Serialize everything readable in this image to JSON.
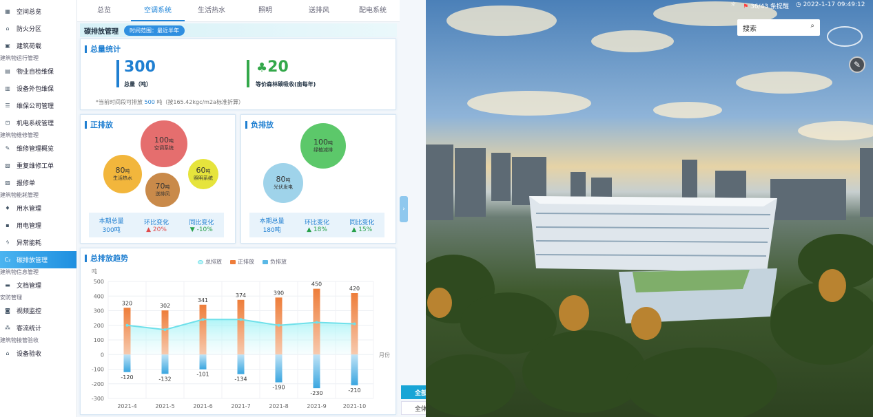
{
  "sidebar": {
    "entries": [
      {
        "type": "item",
        "label": "空间总览",
        "icon": "grid-icon",
        "glyph": "▦"
      },
      {
        "type": "item",
        "label": "防火分区",
        "icon": "home-icon",
        "glyph": "⌂"
      },
      {
        "type": "item",
        "label": "建筑荷载",
        "icon": "building-icon",
        "glyph": "▣"
      },
      {
        "type": "group",
        "label": "建筑物运行管理"
      },
      {
        "type": "item",
        "label": "物业自检维保",
        "icon": "clipboard-icon",
        "glyph": "▤"
      },
      {
        "type": "item",
        "label": "设备外包维保",
        "icon": "box-icon",
        "glyph": "▥"
      },
      {
        "type": "item",
        "label": "维保公司管理",
        "icon": "list-icon",
        "glyph": "☰"
      },
      {
        "type": "item",
        "label": "机电系统管理",
        "icon": "car-icon",
        "glyph": "⊡"
      },
      {
        "type": "group",
        "label": "建筑物维修管理"
      },
      {
        "type": "item",
        "label": "维修管理概览",
        "icon": "wrench-icon",
        "glyph": "✎"
      },
      {
        "type": "item",
        "label": "重复维修工单",
        "icon": "order-icon",
        "glyph": "▧"
      },
      {
        "type": "item",
        "label": "报修单",
        "icon": "form-icon",
        "glyph": "▨"
      },
      {
        "type": "group",
        "label": "建筑物能耗管理"
      },
      {
        "type": "item",
        "label": "用水管理",
        "icon": "drop-icon",
        "glyph": "♦"
      },
      {
        "type": "item",
        "label": "用电管理",
        "icon": "plug-icon",
        "glyph": "▪"
      },
      {
        "type": "item",
        "label": "异常能耗",
        "icon": "lightning-icon",
        "glyph": "ϟ"
      },
      {
        "type": "item",
        "label": "碳排放管理",
        "icon": "co2-icon",
        "glyph": "C₂",
        "active": true
      },
      {
        "type": "group",
        "label": "建筑物信息管理"
      },
      {
        "type": "item",
        "label": "文档管理",
        "icon": "folder-icon",
        "glyph": "▬"
      },
      {
        "type": "group",
        "label": "安防管理"
      },
      {
        "type": "item",
        "label": "视频监控",
        "icon": "camera-icon",
        "glyph": "◙"
      },
      {
        "type": "item",
        "label": "客流统计",
        "icon": "people-icon",
        "glyph": "⁂"
      },
      {
        "type": "group",
        "label": "建筑物接管验收"
      },
      {
        "type": "item",
        "label": "设备验收",
        "icon": "check-home-icon",
        "glyph": "⌂"
      }
    ],
    "top_cut_label": "空间总览"
  },
  "tabs": [
    "总览",
    "空调系统",
    "生活热水",
    "照明",
    "送排风",
    "配电系统"
  ],
  "active_tab": 1,
  "subbar": {
    "title": "碳排放管理",
    "pill": "时间范围：最近半年"
  },
  "total": {
    "title": "总量统计",
    "value": "300",
    "value_label": "总量（吨）",
    "forest_value": "20",
    "forest_label": "等价森林碳吸收(亩每年)",
    "note_prefix": "*当前时间段可排放",
    "note_value": "500",
    "note_suffix": "吨（按165.42kgc/m2a标准折算）"
  },
  "positive": {
    "title": "正排放",
    "bubbles": [
      {
        "value": "100",
        "unit": "吨",
        "label": "空调系统",
        "color": "#e56e6e"
      },
      {
        "value": "80",
        "unit": "吨",
        "label": "生活热水",
        "color": "#f2b63c"
      },
      {
        "value": "70",
        "unit": "吨",
        "label": "送排风",
        "color": "#c98a4a"
      },
      {
        "value": "60",
        "unit": "吨",
        "label": "照明系统",
        "color": "#e6e43c"
      }
    ],
    "stats": {
      "k1": "本期总量",
      "v1": "300吨",
      "k2": "环比变化",
      "v2": "▲ 20%",
      "k3": "同比变化",
      "v3": "▼ -10%"
    }
  },
  "negative": {
    "title": "负排放",
    "bubbles": [
      {
        "value": "100",
        "unit": "吨",
        "label": "绿植减排",
        "color": "#5cc86a"
      },
      {
        "value": "80",
        "unit": "吨",
        "label": "光伏发电",
        "color": "#9fd3ea"
      }
    ],
    "stats": {
      "k1": "本期总量",
      "v1": "180吨",
      "k2": "环比变化",
      "v2": "▲ 18%",
      "k3": "同比变化",
      "v3": "▲ 15%"
    }
  },
  "trend": {
    "title": "总排放趋势",
    "legend": [
      "总排放",
      "正排放",
      "负排放"
    ]
  },
  "chart_data": {
    "type": "bar",
    "categories": [
      "2021-4",
      "2021-5",
      "2021-6",
      "2021-7",
      "2021-8",
      "2021-9",
      "2021-10"
    ],
    "series": [
      {
        "name": "正排放",
        "values": [
          320,
          302,
          341,
          374,
          390,
          450,
          420
        ],
        "color": "#ee7d3a"
      },
      {
        "name": "负排放",
        "values": [
          -120,
          -132,
          -101,
          -134,
          -190,
          -230,
          -210
        ],
        "color": "#5ab8e6"
      },
      {
        "name": "总排放",
        "values": [
          200,
          170,
          240,
          240,
          200,
          220,
          210
        ],
        "color": "#6fe0ea"
      }
    ],
    "ylim": [
      -300,
      500
    ],
    "yticks": [
      500,
      400,
      300,
      200,
      100,
      0,
      -100,
      -200,
      -300
    ],
    "ylabel": "吨",
    "xlabel": "月份"
  },
  "right": {
    "flag_text": "36/43 条提醒",
    "datetime": "2022-1-17 09:49:12",
    "search_placeholder": "搜索",
    "btn_all": "全部",
    "btn_all2": "全体"
  }
}
